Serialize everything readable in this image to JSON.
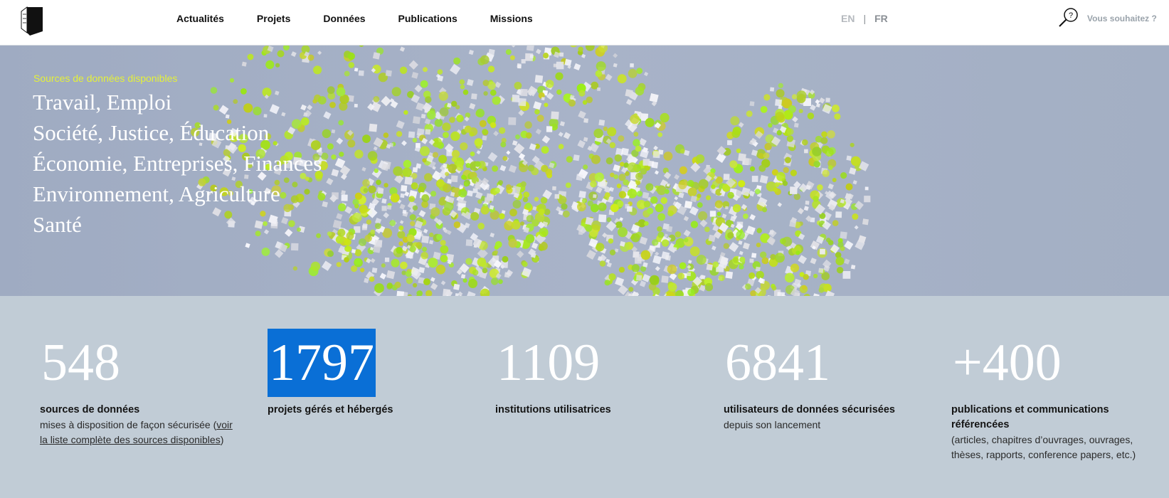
{
  "header": {
    "logo": "casd-logo-icon",
    "nav": [
      "Actualités",
      "Projets",
      "Données",
      "Publications",
      "Missions"
    ],
    "lang": {
      "en": "EN",
      "sep": "|",
      "fr": "FR"
    },
    "search_label": "Vous souhaitez ?",
    "search_icon": "question-search-icon"
  },
  "hero": {
    "kicker": "Sources de données disponibles",
    "topics": [
      "Travail, Emploi",
      "Société, Justice, Éducation",
      "Économie, Entreprises, Finances",
      "Environnement, Agriculture",
      "Santé"
    ],
    "accent_color": "#e4f03a"
  },
  "stats": [
    {
      "value": "548",
      "label": "sources de données",
      "desc_pre": "mises à disposition de façon sécurisée (",
      "link": "voir la liste complète des sources disponibles",
      "desc_post": ")"
    },
    {
      "value": "1797",
      "label": "projets gérés et hébergés"
    },
    {
      "value": "1109",
      "label": "institutions utilisatrices"
    },
    {
      "value": "6841",
      "label": "utilisateurs de données sécurisées",
      "desc": "depuis son lancement"
    },
    {
      "value": "+400",
      "label": "publications et communications référencées",
      "desc": "(articles, chapitres d’ouvrages, ouvrages, thèses, rapports, conference papers, etc.)"
    }
  ],
  "colors": {
    "selection": "#0a6fd6",
    "stats_bg": "#c1ccd6"
  }
}
